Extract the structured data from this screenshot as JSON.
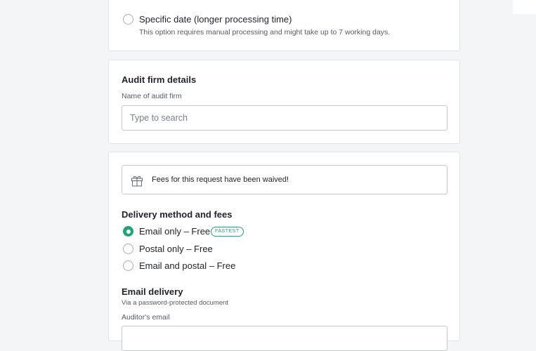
{
  "specific_date": {
    "label": "Specific date (longer processing time)",
    "hint": "This option requires manual processing and might take up to 7 working days."
  },
  "audit_firm": {
    "heading": "Audit firm details",
    "field_label": "Name of audit firm",
    "placeholder": "Type to search"
  },
  "delivery": {
    "notice": "Fees for this request have been waived!",
    "heading": "Delivery method and fees",
    "options": [
      {
        "label": "Email only – Free",
        "badge": "FASTEST",
        "selected": true
      },
      {
        "label": "Postal only – Free",
        "selected": false
      },
      {
        "label": "Email and postal – Free",
        "selected": false
      }
    ],
    "email_heading": "Email delivery",
    "email_sub": "Via a password-protected document",
    "auditor_email_label": "Auditor's email"
  },
  "colors": {
    "accent": "#1fa37a",
    "border": "#dfe2e6",
    "background": "#f4f5f7"
  }
}
